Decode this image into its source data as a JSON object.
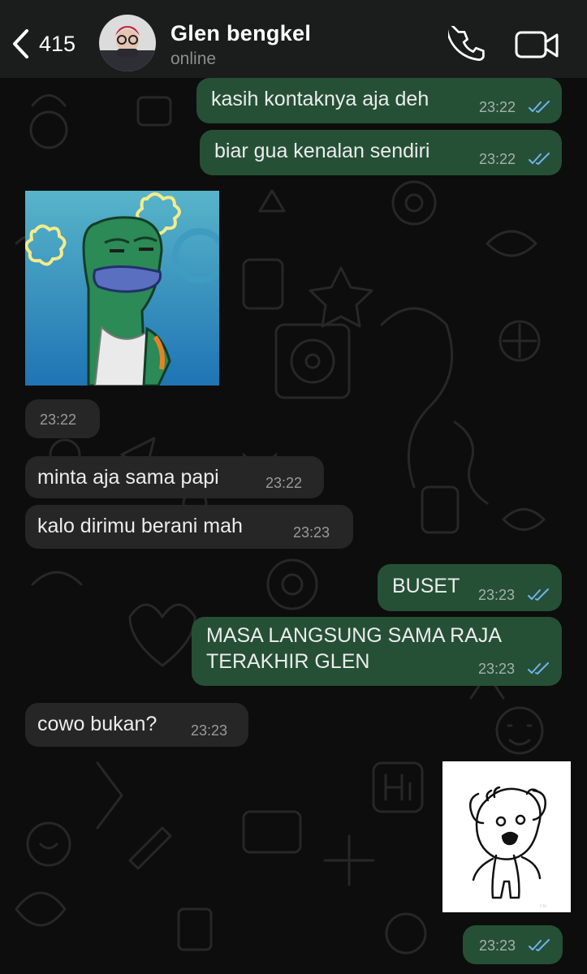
{
  "header": {
    "back_count": "415",
    "contact_name": "Glen bengkel",
    "status": "online"
  },
  "messages": [
    {
      "id": "m1",
      "direction": "outgoing",
      "text": "kasih kontaknya aja deh",
      "time": "23:22",
      "read": true
    },
    {
      "id": "m2",
      "direction": "outgoing",
      "text": "biar gua kenalan sendiri",
      "time": "23:22",
      "read": true
    },
    {
      "id": "m3",
      "direction": "incoming",
      "type": "sticker",
      "sticker": "annoyed-fish-sticker",
      "time": "23:22"
    },
    {
      "id": "m4",
      "direction": "incoming",
      "text": "minta aja sama papi",
      "time": "23:22"
    },
    {
      "id": "m5",
      "direction": "incoming",
      "text": "kalo dirimu berani mah",
      "time": "23:23"
    },
    {
      "id": "m6",
      "direction": "outgoing",
      "text": "BUSET",
      "time": "23:23",
      "read": true
    },
    {
      "id": "m7",
      "direction": "outgoing",
      "text": "MASA LANGSUNG SAMA RAJA\nTERAKHIR GLEN",
      "time": "23:23",
      "read": true
    },
    {
      "id": "m8",
      "direction": "incoming",
      "text": "cowo bukan?",
      "time": "23:23"
    },
    {
      "id": "m9",
      "direction": "outgoing",
      "type": "sticker",
      "sticker": "shocked-doodle-sticker",
      "time": "23:23",
      "read": true
    }
  ],
  "icons": {
    "back": "chevron-left-icon",
    "call": "phone-icon",
    "video": "video-camera-icon",
    "read_receipt": "double-check-icon"
  },
  "colors": {
    "outgoing_bubble": "#255036",
    "incoming_bubble": "#262626",
    "read_tick": "#6fb2ee",
    "header_bg": "#1b1c1c"
  }
}
